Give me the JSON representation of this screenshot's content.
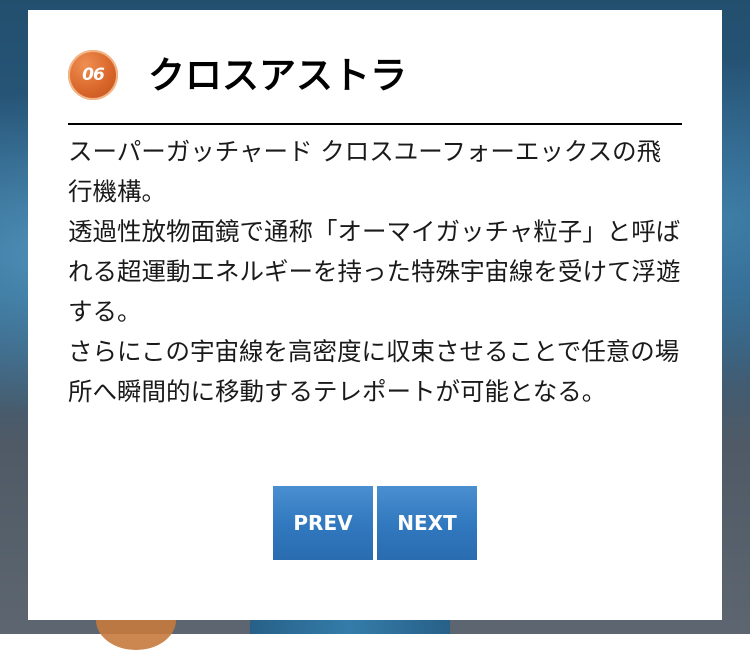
{
  "dialog": {
    "badge_text": "06",
    "badge_color": "#d9662a",
    "title": "クロスアストラ",
    "paragraphs": [
      "スーパーガッチャード クロスユーフォーエックスの飛行機構。",
      "透過性放物面鏡で通称「オーマイガッチャ粒子」と呼ばれる超運動エネルギーを持った特殊宇宙線を受けて浮遊する。",
      "さらにこの宇宙線を高密度に収束させることで任意の場所へ瞬間的に移動するテレポートが可能となる。"
    ],
    "buttons": {
      "prev_label": "PREV",
      "next_label": "NEXT"
    },
    "button_color": "#3279bf"
  }
}
